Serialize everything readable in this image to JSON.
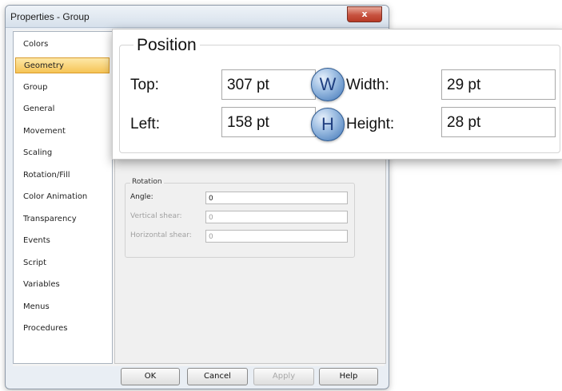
{
  "window": {
    "title": "Properties - Group",
    "close_label": "x"
  },
  "nav": {
    "items": [
      {
        "label": "Colors"
      },
      {
        "label": "Geometry"
      },
      {
        "label": "Group"
      },
      {
        "label": "General"
      },
      {
        "label": "Movement"
      },
      {
        "label": "Scaling"
      },
      {
        "label": "Rotation/Fill"
      },
      {
        "label": "Color Animation"
      },
      {
        "label": "Transparency"
      },
      {
        "label": "Events"
      },
      {
        "label": "Script"
      },
      {
        "label": "Variables"
      },
      {
        "label": "Menus"
      },
      {
        "label": "Procedures"
      }
    ],
    "selected": "Geometry"
  },
  "rotation": {
    "title": "Rotation",
    "angle_label": "Angle:",
    "angle_value": "0",
    "vshear_label": "Vertical shear:",
    "vshear_value": "0",
    "hshear_label": "Horizontal shear:",
    "hshear_value": "0"
  },
  "footer": {
    "ok": "OK",
    "cancel": "Cancel",
    "apply": "Apply",
    "help": "Help"
  },
  "position": {
    "title": "Position",
    "top_label": "Top:",
    "top_value": "307 pt",
    "left_label": "Left:",
    "left_value": "158 pt",
    "width_label": "Width:",
    "width_value": "29 pt",
    "height_label": "Height:",
    "height_value": "28 pt",
    "width_badge": "W",
    "height_badge": "H"
  },
  "colors": {
    "selected_bg": "#f6c456",
    "badge_blue": "#3f75b6",
    "close_red": "#c75340"
  }
}
